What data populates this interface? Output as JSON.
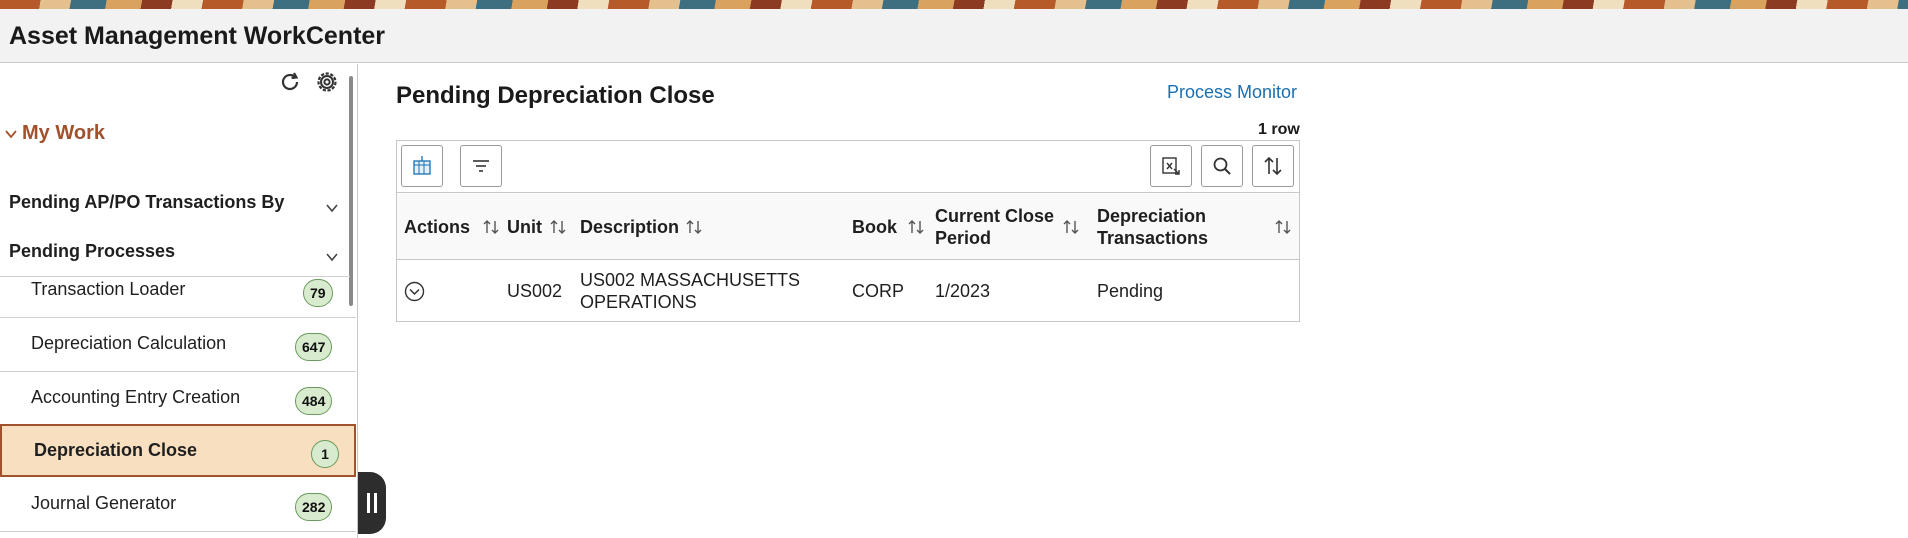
{
  "app": {
    "title": "Asset Management WorkCenter"
  },
  "sidebar": {
    "section_title": "My Work",
    "groups": [
      {
        "label": "Pending AP/PO Transactions By"
      },
      {
        "label": "Pending Processes"
      }
    ],
    "items": [
      {
        "label": "Transaction Loader",
        "count": "79",
        "active": false
      },
      {
        "label": "Depreciation Calculation",
        "count": "647",
        "active": false
      },
      {
        "label": "Accounting Entry Creation",
        "count": "484",
        "active": false
      },
      {
        "label": "Depreciation Close",
        "count": "1",
        "active": true
      },
      {
        "label": "Journal Generator",
        "count": "282",
        "active": false
      }
    ],
    "icons": [
      "refresh-icon",
      "gear-icon",
      "chevron-down-icon"
    ]
  },
  "main": {
    "title": "Pending Depreciation Close",
    "process_monitor_link": "Process Monitor",
    "row_count": "1 row",
    "toolbar_icons": [
      "grid-personalize-icon",
      "filter-icon",
      "export-icon",
      "search-icon",
      "sort-icon"
    ],
    "columns": [
      "Actions",
      "Unit",
      "Description",
      "Book",
      "Current Close Period",
      "Depreciation Transactions"
    ],
    "rows": [
      {
        "unit": "US002",
        "description": "US002 MASSACHUSETTS OPERATIONS",
        "book": "CORP",
        "period": "1/2023",
        "transactions": "Pending"
      }
    ]
  },
  "colors": {
    "accent_brown": "#a0522d",
    "link_blue": "#1a6fb0",
    "badge_green": "#d9ebcf",
    "active_bg": "#f8dfbf"
  }
}
